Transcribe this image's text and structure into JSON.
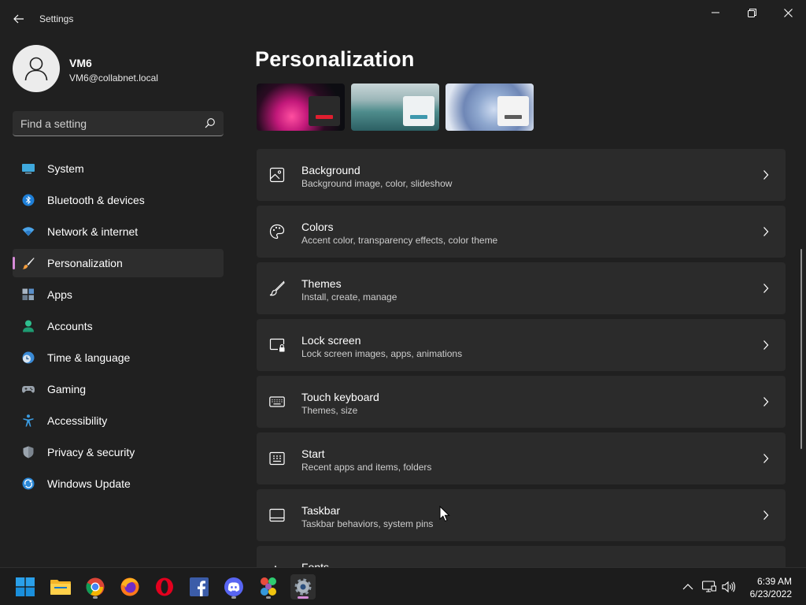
{
  "window": {
    "title": "Settings"
  },
  "profile": {
    "name": "VM6",
    "email": "VM6@collabnet.local"
  },
  "search": {
    "placeholder": "Find a setting"
  },
  "sidebar": {
    "items": [
      {
        "label": "System",
        "icon": "system-icon"
      },
      {
        "label": "Bluetooth & devices",
        "icon": "bluetooth-icon"
      },
      {
        "label": "Network & internet",
        "icon": "wifi-icon"
      },
      {
        "label": "Personalization",
        "icon": "brush-icon",
        "active": true
      },
      {
        "label": "Apps",
        "icon": "apps-icon"
      },
      {
        "label": "Accounts",
        "icon": "accounts-icon"
      },
      {
        "label": "Time & language",
        "icon": "clock-globe-icon"
      },
      {
        "label": "Gaming",
        "icon": "gamepad-icon"
      },
      {
        "label": "Accessibility",
        "icon": "accessibility-icon"
      },
      {
        "label": "Privacy & security",
        "icon": "shield-icon"
      },
      {
        "label": "Windows Update",
        "icon": "update-icon"
      }
    ]
  },
  "main": {
    "title": "Personalization",
    "themes": [
      "theme-glow",
      "theme-lake",
      "theme-bloom"
    ],
    "cards": [
      {
        "title": "Background",
        "subtitle": "Background image, color, slideshow",
        "icon": "image-icon"
      },
      {
        "title": "Colors",
        "subtitle": "Accent color, transparency effects, color theme",
        "icon": "palette-icon"
      },
      {
        "title": "Themes",
        "subtitle": "Install, create, manage",
        "icon": "brush-icon"
      },
      {
        "title": "Lock screen",
        "subtitle": "Lock screen images, apps, animations",
        "icon": "lock-screen-icon"
      },
      {
        "title": "Touch keyboard",
        "subtitle": "Themes, size",
        "icon": "keyboard-icon"
      },
      {
        "title": "Start",
        "subtitle": "Recent apps and items, folders",
        "icon": "start-icon"
      },
      {
        "title": "Taskbar",
        "subtitle": "Taskbar behaviors, system pins",
        "icon": "taskbar-icon"
      },
      {
        "title": "Fonts",
        "subtitle": "",
        "icon": "fonts-icon"
      }
    ]
  },
  "taskbar": {
    "apps": [
      "start-icon",
      "file-explorer-icon",
      "chrome-icon",
      "firefox-icon",
      "opera-icon",
      "facebook-icon",
      "discord-icon",
      "photos-icon",
      "settings-icon"
    ],
    "tray": [
      "chevron-up-icon",
      "network-icon",
      "volume-icon"
    ],
    "time": "6:39 AM",
    "date": "6/23/2022"
  },
  "colors": {
    "background": "#202020",
    "card": "#2b2b2b",
    "accent": "#d68bd8"
  }
}
